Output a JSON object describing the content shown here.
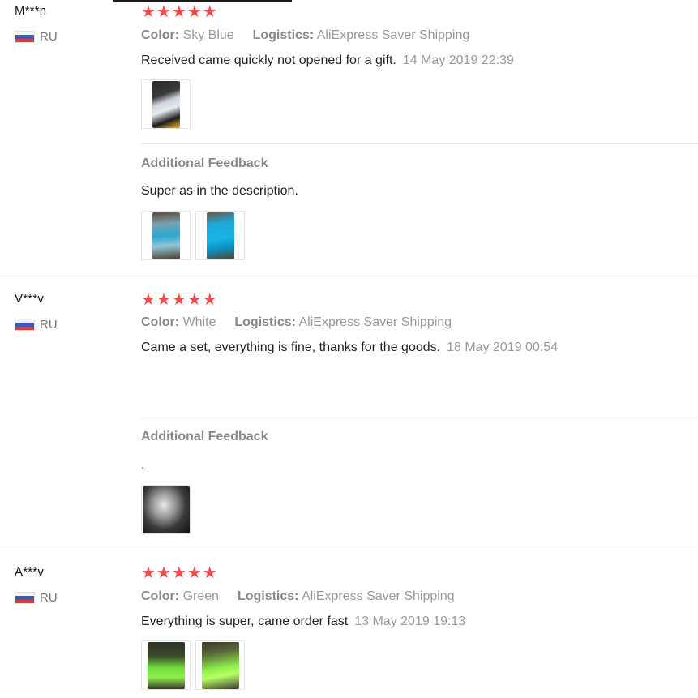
{
  "reviews": [
    {
      "user": "M***n",
      "country": "RU",
      "rating": 5,
      "color_label": "Color:",
      "color_value": "Sky Blue",
      "logistics_label": "Logistics:",
      "logistics_value": "AliExpress Saver Shipping",
      "text": "Received came quickly not opened for a gift.",
      "date": "14 May 2019 22:39",
      "additional_title": "Additional Feedback",
      "additional_text": "Super as in the description."
    },
    {
      "user": "V***v",
      "country": "RU",
      "rating": 5,
      "color_label": "Color:",
      "color_value": "White",
      "logistics_label": "Logistics:",
      "logistics_value": "AliExpress Saver Shipping",
      "text": "Came a set, everything is fine, thanks for the goods.",
      "date": "18 May 2019 00:54",
      "additional_title": "Additional Feedback",
      "additional_text": "."
    },
    {
      "user": "A***v",
      "country": "RU",
      "rating": 5,
      "color_label": "Color:",
      "color_value": "Green",
      "logistics_label": "Logistics:",
      "logistics_value": "AliExpress Saver Shipping",
      "text": "Everything is super, came order fast",
      "date": "13 May 2019 19:13"
    }
  ],
  "colors": {
    "star": "#f04a4a",
    "muted_text": "#999999",
    "divider": "#e5e5e5"
  }
}
